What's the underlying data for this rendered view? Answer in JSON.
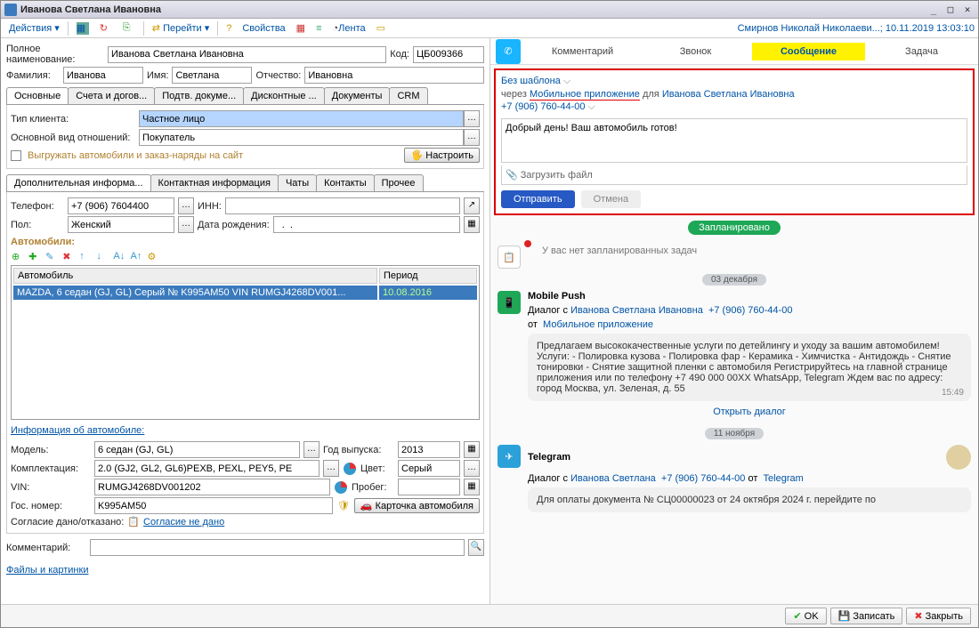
{
  "title": "Иванова Светлана Ивановна",
  "toolbar": {
    "actions": "Действия",
    "goto": "Перейти",
    "props": "Свойства",
    "feed": "Лента"
  },
  "user_status": "Смирнов Николай Николаеви...; 10.11.2019 13:03:10",
  "form": {
    "full_name_lbl": "Полное наименование:",
    "full_name": "Иванова Светлана Ивановна",
    "code_lbl": "Код:",
    "code": "ЦБ009366",
    "surname_lbl": "Фамилия:",
    "surname": "Иванова",
    "name_lbl": "Имя:",
    "name": "Светлана",
    "patronymic_lbl": "Отчество:",
    "patronymic": "Ивановна"
  },
  "main_tabs": [
    "Основные",
    "Счета и догов...",
    "Подтв. докуме...",
    "Дисконтные ...",
    "Документы",
    "CRM"
  ],
  "client_type_lbl": "Тип клиента:",
  "client_type": "Частное лицо",
  "rel_lbl": "Основной вид отношений:",
  "rel": "Покупатель",
  "export_chk": "Выгружать автомобили и заказ-наряды на сайт",
  "configure": "Настроить",
  "sub_tabs": [
    "Дополнительная информа...",
    "Контактная информация",
    "Чаты",
    "Контакты",
    "Прочее"
  ],
  "phone_lbl": "Телефон:",
  "phone": "+7 (906) 7604400",
  "inn_lbl": "ИНН:",
  "gender_lbl": "Пол:",
  "gender": "Женский",
  "dob_lbl": "Дата рождения:",
  "dob": "  .  .    ",
  "cars_lbl": "Автомобили:",
  "car_headers": {
    "car": "Автомобиль",
    "period": "Период"
  },
  "car_row": {
    "car": "MAZDA, 6 седан (GJ, GL) Серый № K995AM50 VIN RUMGJ4268DV001...",
    "date": "10.08.2016"
  },
  "car_info_lbl": "Информация об автомобиле:",
  "model_lbl": "Модель:",
  "model": "6 седан (GJ, GL)",
  "year_lbl": "Год выпуска:",
  "year": "2013",
  "compl_lbl": "Комплектация:",
  "compl": "2.0 (GJ2, GL2, GL6)PEXB, PEXL, PEY5, PE",
  "color_lbl": "Цвет:",
  "color": "Серый",
  "vin_lbl": "VIN:",
  "vin": "RUMGJ4268DV001202",
  "mileage_lbl": "Пробег:",
  "gosnum_lbl": "Гос. номер:",
  "gosnum": "K995AM50",
  "car_card": "Карточка автомобиля",
  "consent_lbl": "Согласие дано/отказано:",
  "consent_link": "Согласие не дано",
  "comment_lbl": "Комментарий:",
  "files_link": "Файлы и картинки",
  "right_tabs": [
    "Комментарий",
    "Звонок",
    "Сообщение",
    "Задача"
  ],
  "compose": {
    "no_template": "Без шаблона",
    "via": "через",
    "app": "Мобильное приложение",
    "for": "для",
    "client": "Иванова Светлана Ивановна",
    "phone": "+7 (906) 760-44-00",
    "text": "Добрый день! Ваш автомобиль готов!",
    "attach": "Загрузить файл",
    "send": "Отправить",
    "cancel": "Отмена"
  },
  "planned": "Запланировано",
  "no_tasks": "У вас нет запланированных задач",
  "date1": "03 декабря",
  "push": {
    "title": "Mobile Push",
    "dialog": "Диалог с",
    "client": "Иванова Светлана Ивановна",
    "phone": "+7 (906) 760-44-00",
    "from": "от",
    "app": "Мобильное приложение",
    "msg": "Предлагаем высококачественные услуги по детейлингу и уходу за вашим автомобилем! Услуги: - Полировка кузова - Полировка фар - Керамика - Химчистка - Антидождь - Снятие тонировки - Снятие защитной пленки с автомобиля  Регистрируйтесь на главной странице приложения или по телефону +7 490 000 00XX WhatsApp, Telegram  Ждем вас по адресу: город Москва, ул. Зеленая, д. 55",
    "time": "15:49",
    "open": "Открыть диалог"
  },
  "date2": "11 ноября",
  "tg": {
    "title": "Telegram",
    "dialog": "Диалог с",
    "client": "Иванова Светлана",
    "phone": "+7 (906) 760-44-00",
    "from": "от",
    "app": "Telegram",
    "msg": "Для оплаты документа № СЦ00000023 от 24 октября 2024 г. перейдите по"
  },
  "statusbar": {
    "ok": "OK",
    "save": "Записать",
    "close": "Закрыть"
  }
}
